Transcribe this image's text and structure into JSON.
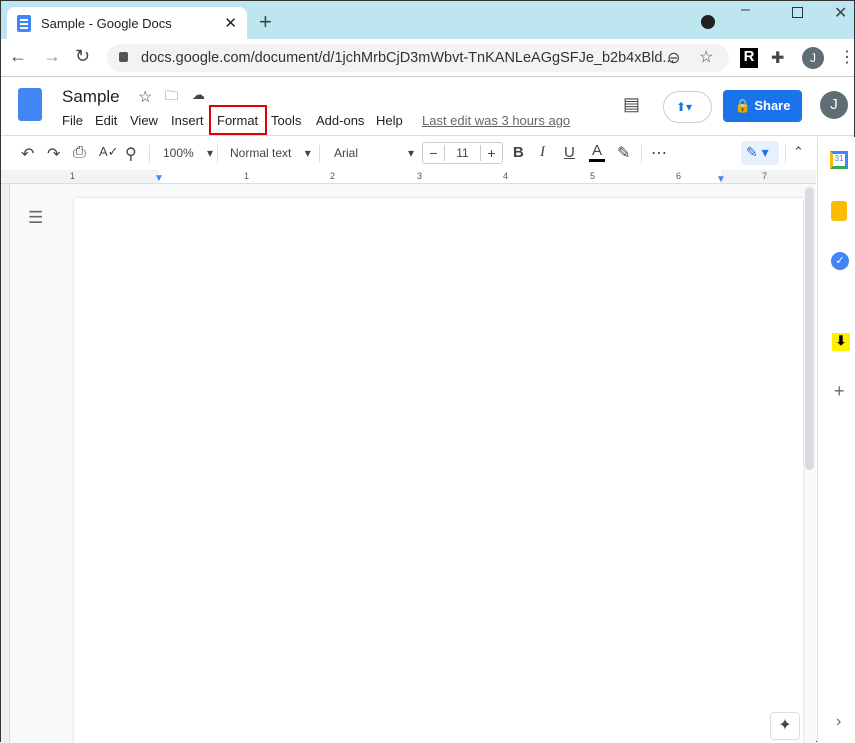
{
  "browser": {
    "tab_title": "Sample - Google Docs",
    "url": "docs.google.com/document/d/1jchMrbCjD3mWbvt-TnKANLeAGgSFJe_b2b4xBld...",
    "profile_initial": "J",
    "extension_label": "R"
  },
  "docs": {
    "title": "Sample",
    "menu": [
      "File",
      "Edit",
      "View",
      "Insert",
      "Format",
      "Tools",
      "Add-ons",
      "Help"
    ],
    "highlighted_menu": "Format",
    "last_edit": "Last edit was 3 hours ago",
    "share_label": "Share",
    "user_initial": "J"
  },
  "toolbar": {
    "zoom": "100%",
    "style": "Normal text",
    "font": "Arial",
    "font_size": "11"
  },
  "ruler": {
    "labels": [
      "1",
      "1",
      "2",
      "3",
      "4",
      "5",
      "6",
      "7"
    ]
  },
  "colors": {
    "accent": "#1a73e8",
    "highlight_box": "#e00000",
    "tabbar": "#bde6f0"
  }
}
